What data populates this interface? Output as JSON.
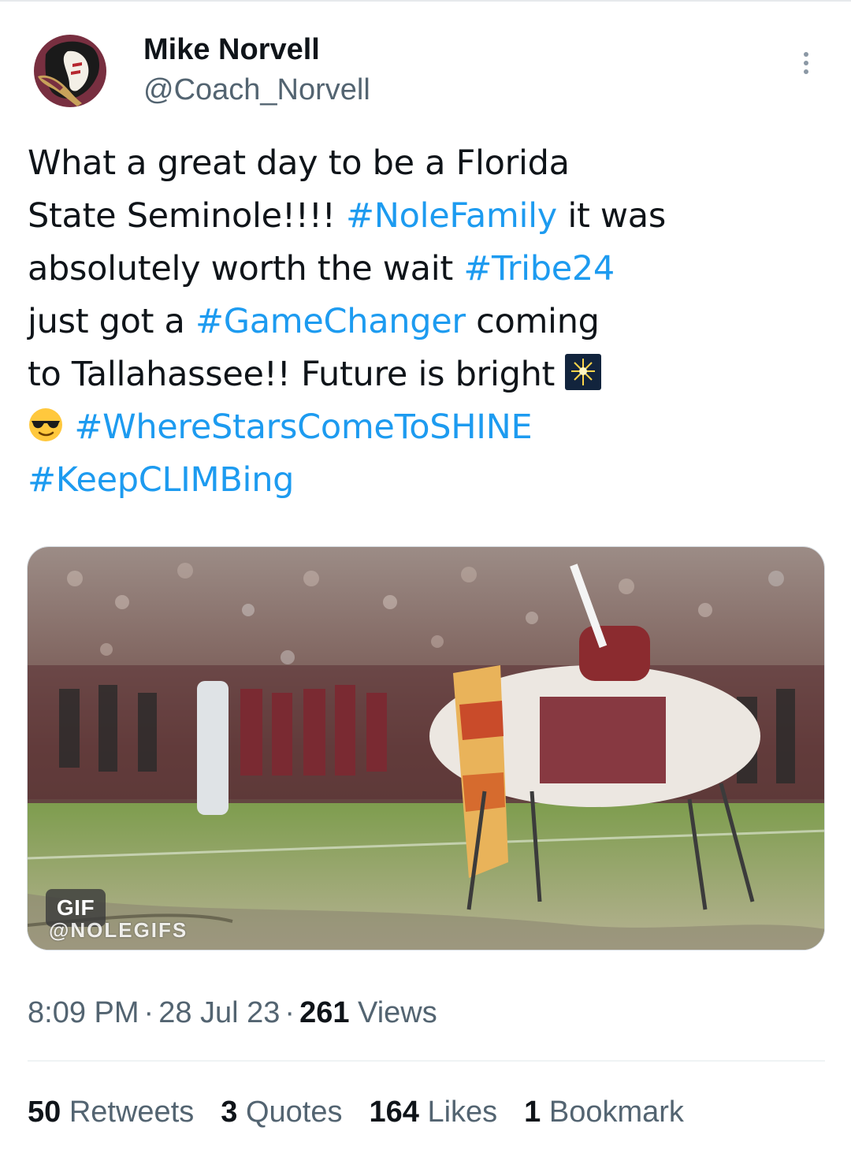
{
  "author": {
    "name": "Mike Norvell",
    "handle": "@Coach_Norvell",
    "avatar_icon": "fsu-seminole-logo-icon"
  },
  "menu": {
    "icon": "more-vertical-icon"
  },
  "tweet": {
    "lines": [
      [
        {
          "text": "What a great day to be a Florida"
        }
      ],
      [
        {
          "text": "State Seminole!!!! "
        },
        {
          "text": "#NoleFamily",
          "hashtag": true
        },
        {
          "text": " it was"
        }
      ],
      [
        {
          "text": "absolutely worth the wait "
        },
        {
          "text": "#Tribe24",
          "hashtag": true
        }
      ],
      [
        {
          "text": "just got a "
        },
        {
          "text": "#GameChanger",
          "hashtag": true
        },
        {
          "text": " coming"
        }
      ],
      [
        {
          "text": "to Tallahassee!! Future is bright "
        },
        {
          "emoji": "sparkler-emoji-icon"
        }
      ],
      [
        {
          "emoji": "sunglasses-face-emoji-icon"
        },
        {
          "text": " "
        },
        {
          "text": "#WhereStarsComeToSHINE",
          "hashtag": true
        }
      ],
      [
        {
          "text": "#KeepCLIMBing",
          "hashtag": true
        }
      ]
    ]
  },
  "media": {
    "badge": "GIF",
    "watermark": "@NOLEGIFS",
    "description_icon": "gif-media-thumbnail"
  },
  "meta": {
    "time": "8:09 PM",
    "date": "28 Jul 23",
    "views_count": "261",
    "views_label": "Views",
    "separator": "·"
  },
  "stats": [
    {
      "count": "50",
      "label": "Retweets"
    },
    {
      "count": "3",
      "label": "Quotes"
    },
    {
      "count": "164",
      "label": "Likes"
    },
    {
      "count": "1",
      "label": "Bookmark"
    }
  ],
  "colors": {
    "hashtag": "#1d9bf0",
    "secondary_text": "#536471",
    "primary_text": "#0f1419"
  }
}
